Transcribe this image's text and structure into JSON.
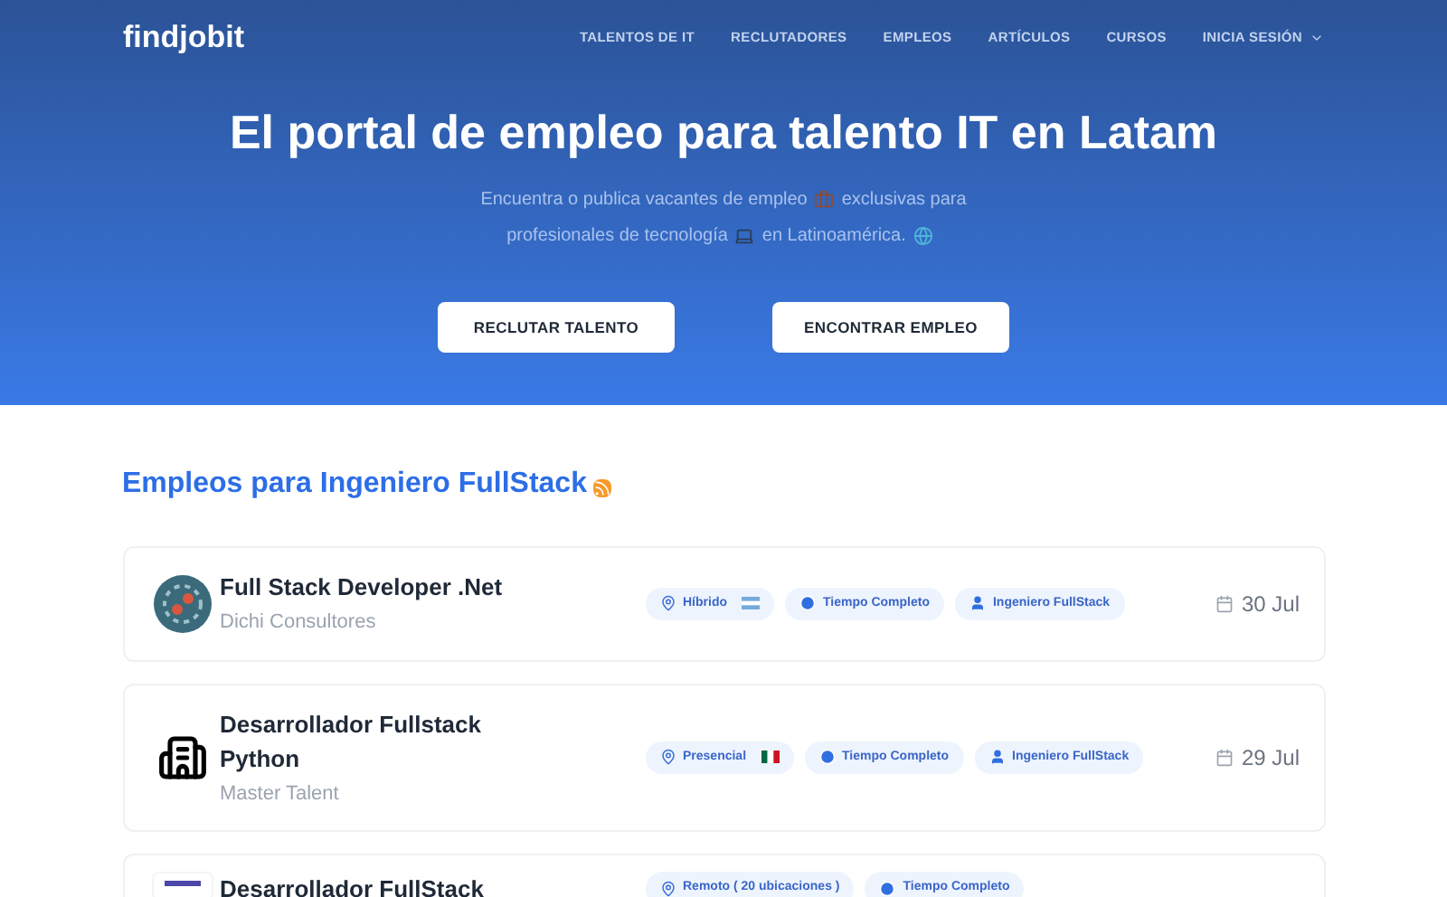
{
  "brand": "findjobit",
  "nav": [
    {
      "label": "TALENTOS DE IT",
      "dropdown": false
    },
    {
      "label": "RECLUTADORES",
      "dropdown": false
    },
    {
      "label": "EMPLEOS",
      "dropdown": false
    },
    {
      "label": "ARTÍCULOS",
      "dropdown": false
    },
    {
      "label": "CURSOS",
      "dropdown": false
    },
    {
      "label": "INICIA SESIÓN",
      "dropdown": true
    }
  ],
  "hero": {
    "title": "El portal de empleo para talento IT en Latam",
    "subtitle_parts": [
      "Encuentra o publica vacantes de empleo",
      "exclusivas para profesionales de tecnología",
      "en Latinoamérica."
    ],
    "buttons": [
      "RECLUTAR TALENTO",
      "ENCONTRAR EMPLEO"
    ]
  },
  "section_title": "Empleos para Ingeniero FullStack",
  "jobs": [
    {
      "title": "Full Stack Developer .Net",
      "company": "Dichi Consultores",
      "logo": {
        "kind": "gear"
      },
      "date": "30 Jul",
      "tags": [
        {
          "kind": "location",
          "text": "Híbrido",
          "flag": {
            "kind": "ar"
          }
        },
        {
          "kind": "time",
          "text": "Tiempo Completo"
        },
        {
          "kind": "role",
          "text": "Ingeniero FullStack"
        }
      ]
    },
    {
      "title": "Desarrollador Fullstack Python",
      "company": "Master Talent",
      "logo": {
        "kind": "building"
      },
      "date": "29 Jul",
      "tags": [
        {
          "kind": "location",
          "text": "Presencial",
          "flag": {
            "kind": "mx"
          }
        },
        {
          "kind": "time",
          "text": "Tiempo Completo"
        },
        {
          "kind": "role",
          "text": "Ingeniero FullStack"
        }
      ]
    },
    {
      "title": "Desarrollador FullStack",
      "logo": {
        "kind": "small"
      },
      "tags": [
        {
          "kind": "location",
          "text": "Remoto ( 20 ubicaciones )"
        },
        {
          "kind": "time",
          "text": "Tiempo Completo"
        }
      ]
    }
  ]
}
